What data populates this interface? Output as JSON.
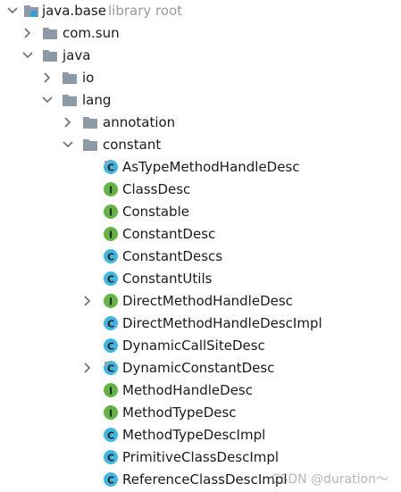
{
  "tree": {
    "root": {
      "name": "java.base",
      "hint": "library root",
      "expanded": true,
      "icon": "library-module-icon"
    },
    "com_sun": {
      "name": "com.sun",
      "expanded": false,
      "icon": "folder-icon"
    },
    "java": {
      "name": "java",
      "expanded": true,
      "icon": "folder-icon"
    },
    "io": {
      "name": "io",
      "expanded": false,
      "icon": "folder-icon"
    },
    "lang": {
      "name": "lang",
      "expanded": true,
      "icon": "folder-icon"
    },
    "annotation": {
      "name": "annotation",
      "expanded": false,
      "icon": "folder-icon"
    },
    "constant": {
      "name": "constant",
      "expanded": true,
      "icon": "folder-icon"
    },
    "constant_items": [
      {
        "name": "AsTypeMethodHandleDesc",
        "kind": "class",
        "icon_letter": "C",
        "expandable": false
      },
      {
        "name": "ClassDesc",
        "kind": "interface",
        "icon_letter": "I",
        "expandable": false
      },
      {
        "name": "Constable",
        "kind": "interface",
        "icon_letter": "I",
        "expandable": false
      },
      {
        "name": "ConstantDesc",
        "kind": "interface",
        "icon_letter": "I",
        "expandable": false
      },
      {
        "name": "ConstantDescs",
        "kind": "class",
        "icon_letter": "C",
        "expandable": false
      },
      {
        "name": "ConstantUtils",
        "kind": "class",
        "icon_letter": "C",
        "expandable": false
      },
      {
        "name": "DirectMethodHandleDesc",
        "kind": "interface",
        "icon_letter": "I",
        "expandable": true
      },
      {
        "name": "DirectMethodHandleDescImpl",
        "kind": "class",
        "icon_letter": "C",
        "expandable": false
      },
      {
        "name": "DynamicCallSiteDesc",
        "kind": "class",
        "icon_letter": "C",
        "expandable": false
      },
      {
        "name": "DynamicConstantDesc",
        "kind": "class",
        "icon_letter": "C",
        "expandable": true
      },
      {
        "name": "MethodHandleDesc",
        "kind": "interface",
        "icon_letter": "I",
        "expandable": false
      },
      {
        "name": "MethodTypeDesc",
        "kind": "interface",
        "icon_letter": "I",
        "expandable": false
      },
      {
        "name": "MethodTypeDescImpl",
        "kind": "class",
        "icon_letter": "C",
        "expandable": false
      },
      {
        "name": "PrimitiveClassDescImpl",
        "kind": "class",
        "icon_letter": "C",
        "expandable": false
      },
      {
        "name": "ReferenceClassDescImpl",
        "kind": "class",
        "icon_letter": "C",
        "expandable": false
      }
    ]
  },
  "colors": {
    "folder": "#8d9aa5",
    "arrow": "#6e6e6e",
    "class_icon": "#40b6e0",
    "interface_icon": "#62b543",
    "icon_letter": "#231f20",
    "library_blue": "#389fd6",
    "hint_text": "#9a9a9a"
  },
  "watermark": "CSDN @duration～"
}
